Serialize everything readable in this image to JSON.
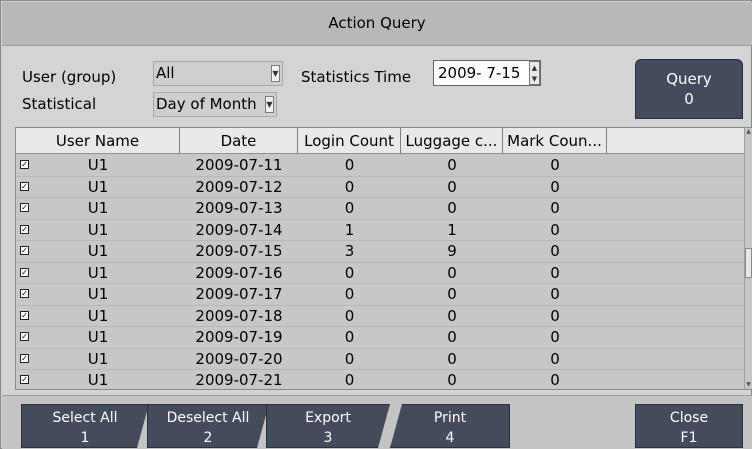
{
  "window": {
    "title": "Action Query"
  },
  "filters": {
    "user_group_label": "User (group)",
    "user_group_value": "All",
    "statistical_label": "Statistical",
    "statistical_value": "Day of Month",
    "statistics_time_label": "Statistics Time",
    "statistics_time_value": "2009- 7-15"
  },
  "query_button": {
    "label": "Query",
    "key": "0"
  },
  "table": {
    "columns": [
      "User Name",
      "Date",
      "Login Count",
      "Luggage c...",
      "Mark Coun..."
    ],
    "rows": [
      {
        "user": "U1",
        "date": "2009-07-11",
        "login": "0",
        "luggage": "0",
        "mark": "0"
      },
      {
        "user": "U1",
        "date": "2009-07-12",
        "login": "0",
        "luggage": "0",
        "mark": "0"
      },
      {
        "user": "U1",
        "date": "2009-07-13",
        "login": "0",
        "luggage": "0",
        "mark": "0"
      },
      {
        "user": "U1",
        "date": "2009-07-14",
        "login": "1",
        "luggage": "1",
        "mark": "0"
      },
      {
        "user": "U1",
        "date": "2009-07-15",
        "login": "3",
        "luggage": "9",
        "mark": "0"
      },
      {
        "user": "U1",
        "date": "2009-07-16",
        "login": "0",
        "luggage": "0",
        "mark": "0"
      },
      {
        "user": "U1",
        "date": "2009-07-17",
        "login": "0",
        "luggage": "0",
        "mark": "0"
      },
      {
        "user": "U1",
        "date": "2009-07-18",
        "login": "0",
        "luggage": "0",
        "mark": "0"
      },
      {
        "user": "U1",
        "date": "2009-07-19",
        "login": "0",
        "luggage": "0",
        "mark": "0"
      },
      {
        "user": "U1",
        "date": "2009-07-20",
        "login": "0",
        "luggage": "0",
        "mark": "0"
      },
      {
        "user": "U1",
        "date": "2009-07-21",
        "login": "0",
        "luggage": "0",
        "mark": "0"
      }
    ]
  },
  "buttons": {
    "select_all": {
      "label": "Select All",
      "key": "1"
    },
    "deselect_all": {
      "label": "Deselect All",
      "key": "2"
    },
    "export": {
      "label": "Export",
      "key": "3"
    },
    "print": {
      "label": "Print",
      "key": "4"
    },
    "close": {
      "label": "Close",
      "key": "F1"
    }
  },
  "colors": {
    "button_bg": "#444b5d",
    "window_bg": "#d4d4d4",
    "header_bg": "#e9e9e9"
  }
}
